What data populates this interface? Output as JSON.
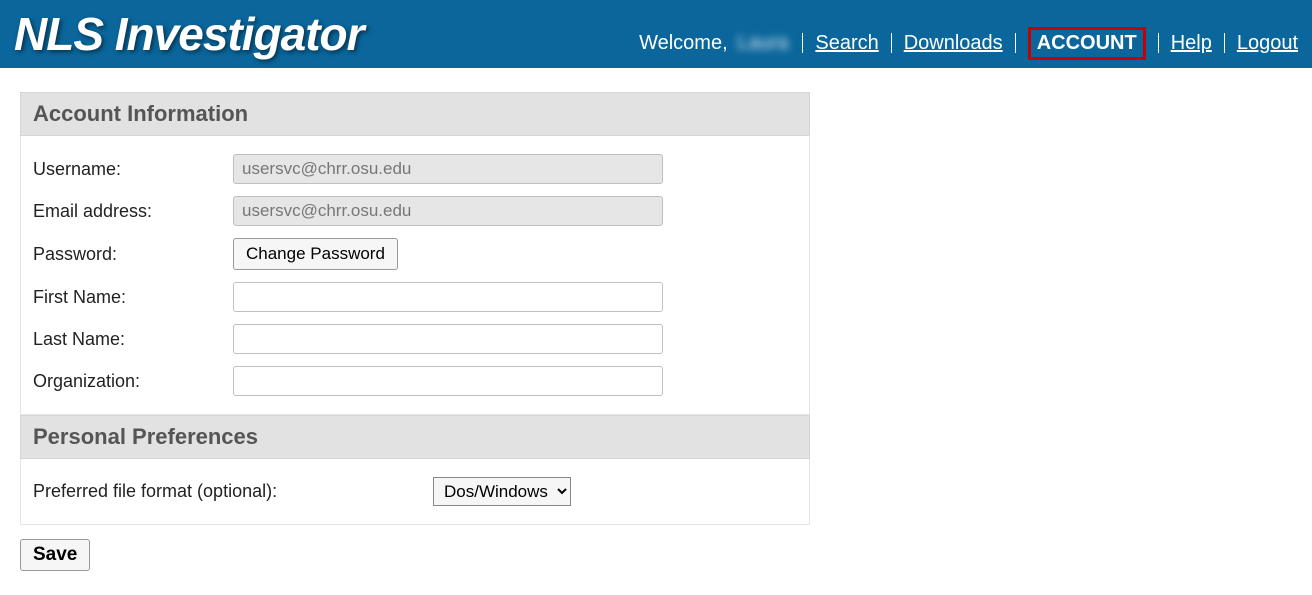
{
  "header": {
    "logo": "NLS Investigator",
    "welcome_prefix": "Welcome,",
    "welcome_user": "Laura",
    "nav": {
      "search": "Search",
      "downloads": "Downloads",
      "account": "ACCOUNT",
      "help": "Help",
      "logout": "Logout"
    }
  },
  "sections": {
    "account_info": "Account Information",
    "personal_prefs": "Personal Preferences"
  },
  "labels": {
    "username": "Username:",
    "email": "Email address:",
    "password": "Password:",
    "first_name": "First Name:",
    "last_name": "Last Name:",
    "organization": "Organization:",
    "preferred_format": "Preferred file format (optional):"
  },
  "values": {
    "username": "usersvc@chrr.osu.edu",
    "email": "usersvc@chrr.osu.edu",
    "first_name": "",
    "last_name": "",
    "organization": "",
    "file_format": "Dos/Windows"
  },
  "buttons": {
    "change_password": "Change Password",
    "save": "Save"
  }
}
